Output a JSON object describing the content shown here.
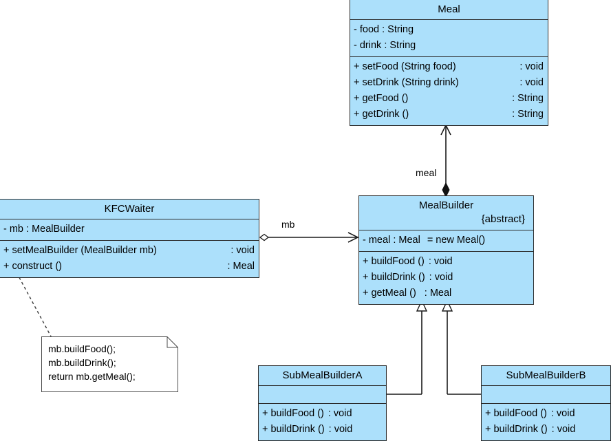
{
  "diagram": {
    "title": "Builder pattern UML class diagram",
    "fill_color": "#ACE0FB",
    "line_color": "#2b2b2b",
    "background": "#ffffff"
  },
  "classes": {
    "meal": {
      "name": "Meal",
      "stereotype": "",
      "attributes": [
        {
          "sig": "-  food   : String",
          "ret": ""
        },
        {
          "sig": "-  drink  : String",
          "ret": ""
        }
      ],
      "operations": [
        {
          "sig": "+  setFood (String food)",
          "ret": ": void"
        },
        {
          "sig": "+  setDrink (String drink)",
          "ret": ": void"
        },
        {
          "sig": "+  getFood ()",
          "ret": ": String"
        },
        {
          "sig": "+  getDrink ()",
          "ret": ": String"
        }
      ]
    },
    "meal_builder": {
      "name": "MealBuilder",
      "stereotype": "{abstract}",
      "attributes": [
        {
          "sig": "-  meal  : Meal",
          "ret": "= new Meal()"
        }
      ],
      "operations": [
        {
          "sig": "+  buildFood ()",
          "ret": ": void"
        },
        {
          "sig": "+  buildDrink ()",
          "ret": ": void"
        },
        {
          "sig": "+  getMeal ()",
          "ret": ": Meal"
        }
      ]
    },
    "kfc_waiter": {
      "name": "KFCWaiter",
      "stereotype": "",
      "attributes": [
        {
          "sig": "-  mb  : MealBuilder",
          "ret": ""
        }
      ],
      "operations": [
        {
          "sig": "+  setMealBuilder (MealBuilder mb)",
          "ret": ": void"
        },
        {
          "sig": "+  construct ()",
          "ret": ": Meal"
        }
      ]
    },
    "sub_a": {
      "name": "SubMealBuilderA",
      "stereotype": "",
      "attributes": [],
      "operations": [
        {
          "sig": "+  buildFood ()",
          "ret": ": void"
        },
        {
          "sig": "+  buildDrink ()",
          "ret": ": void"
        }
      ]
    },
    "sub_b": {
      "name": "SubMealBuilderB",
      "stereotype": "",
      "attributes": [],
      "operations": [
        {
          "sig": "+  buildFood ()",
          "ret": ": void"
        },
        {
          "sig": "+  buildDrink ()",
          "ret": ": void"
        }
      ]
    }
  },
  "note": {
    "lines": [
      "mb.buildFood();",
      "mb.buildDrink();",
      "return mb.getMeal();"
    ]
  },
  "edges": {
    "composition_meal_label": "meal",
    "aggregation_mb_label": "mb"
  }
}
